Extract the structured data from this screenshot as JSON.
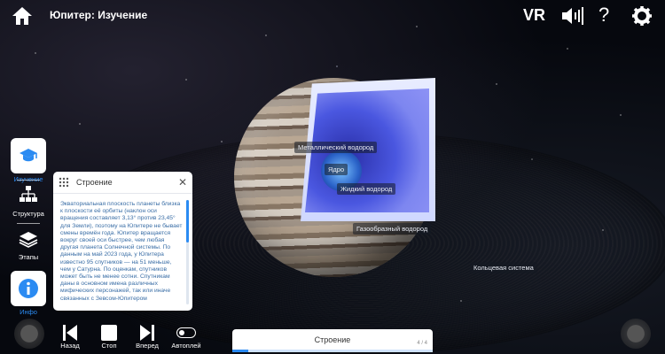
{
  "header": {
    "title": "Юпитер: Изучение",
    "vr_label": "VR",
    "help_label": "?"
  },
  "icons": {
    "home": "home-icon",
    "sound": "speaker-icon",
    "help": "question-icon",
    "settings": "gear-icon"
  },
  "sidebar": {
    "items": [
      {
        "label": "Изучение",
        "icon": "graduation-cap-icon",
        "active": true
      },
      {
        "label": "Структура",
        "icon": "hierarchy-icon",
        "active": false
      },
      {
        "label": "Этапы",
        "icon": "layers-icon",
        "active": false
      },
      {
        "label": "Инфо",
        "icon": "info-icon",
        "active": true
      }
    ]
  },
  "panel": {
    "title": "Строение",
    "text": "Экваториальная плоскость планеты близка к плоскости её орбиты (наклон оси вращения составляет 3,13° против 23,45° для Земли), поэтому на Юпитере не бывает смены времён года. Юпитер вращается вокруг своей оси быстрее, чем любая другая планета Солнечной системы. По данным на май 2023 года, у Юпитера известно 95 спутников — на 51 меньше, чем у Сатурна. По оценкам, спутников может быть не менее сотни. Спутникам даны в основном имена различных мифических персонажей, так или иначе связанных с Зевсом-Юпитером"
  },
  "labels": {
    "metallic_hydrogen": "Металлический водород",
    "core": "Ядро",
    "liquid_hydrogen": "Жидкий водород",
    "gaseous_hydrogen": "Газообразный водород",
    "ring_system": "Кольцевая система"
  },
  "controls": {
    "back": "Назад",
    "stop": "Стоп",
    "forward": "Вперед",
    "autoplay": "Автоплей"
  },
  "bottom_bar": {
    "label": "Строение",
    "count": "4 / 4",
    "progress": 0.08
  },
  "colors": {
    "accent": "#2b8bf2"
  }
}
